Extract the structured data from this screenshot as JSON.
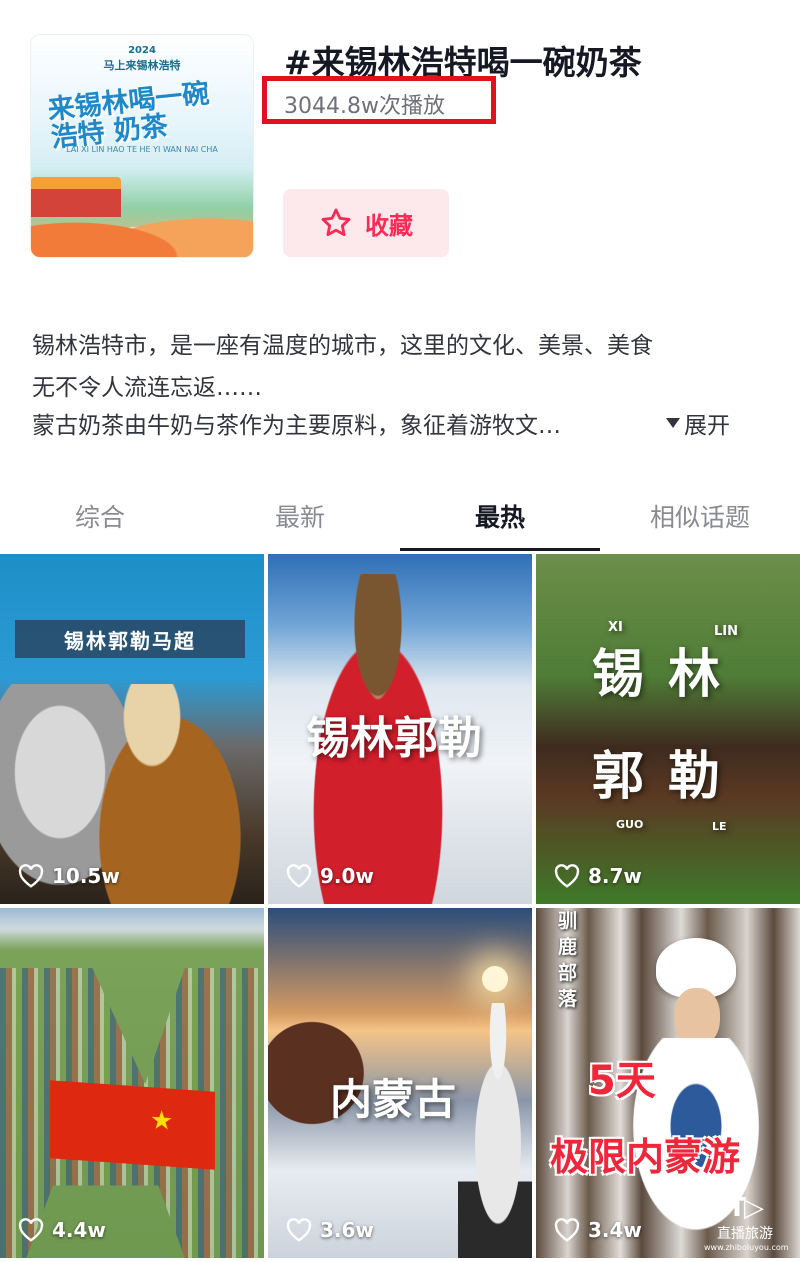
{
  "topic": {
    "cover": {
      "year": "2024",
      "subtitle": "马上来锡林浩特",
      "big_text": "来锡林喝一碗 浩特 奶茶",
      "pinyin": "LAI XI LIN HAO TE HE YI WAN NAI CHA"
    },
    "title": "#来锡林浩特喝一碗奶茶",
    "plays": "3044.8w次播放",
    "favorite_label": "收藏",
    "favorite_icon": "star-outline-icon",
    "accent_color": "#fe2c55",
    "highlight_box_color": "#e3111e"
  },
  "description": {
    "line1": "锡林浩特市，是一座有温度的城市，这里的文化、美景、美食",
    "line2": "无不令人流连忘返……",
    "line3": "蒙古奶茶由牛奶与茶作为主要原料，象征着游牧文…",
    "expand_label": "展开"
  },
  "tabs": [
    {
      "label": "综合",
      "active": false
    },
    {
      "label": "最新",
      "active": false
    },
    {
      "label": "最热",
      "active": true
    },
    {
      "label": "相似话题",
      "active": false
    }
  ],
  "videos": [
    {
      "overlay": "锡林郭勒马超",
      "likes": "10.5w"
    },
    {
      "overlay": "锡林郭勒",
      "likes": "9.0w"
    },
    {
      "overlay_top": "锡林",
      "overlay_bottom": "郭勒",
      "pinyin_top_left": "XI",
      "pinyin_top_right": "LIN",
      "pinyin_bottom_left": "GUO",
      "pinyin_bottom_right": "LE",
      "likes": "8.7w"
    },
    {
      "overlay": "",
      "likes": "4.4w"
    },
    {
      "overlay": "内蒙古",
      "likes": "3.6w"
    },
    {
      "overlay_vertical": "驯鹿部落",
      "overlay_line1": "5天",
      "overlay_line2": "极限内蒙游",
      "likes": "3.4w"
    }
  ],
  "watermark": {
    "name": "直播旅游",
    "url": "www.zhiboluyou.com"
  }
}
